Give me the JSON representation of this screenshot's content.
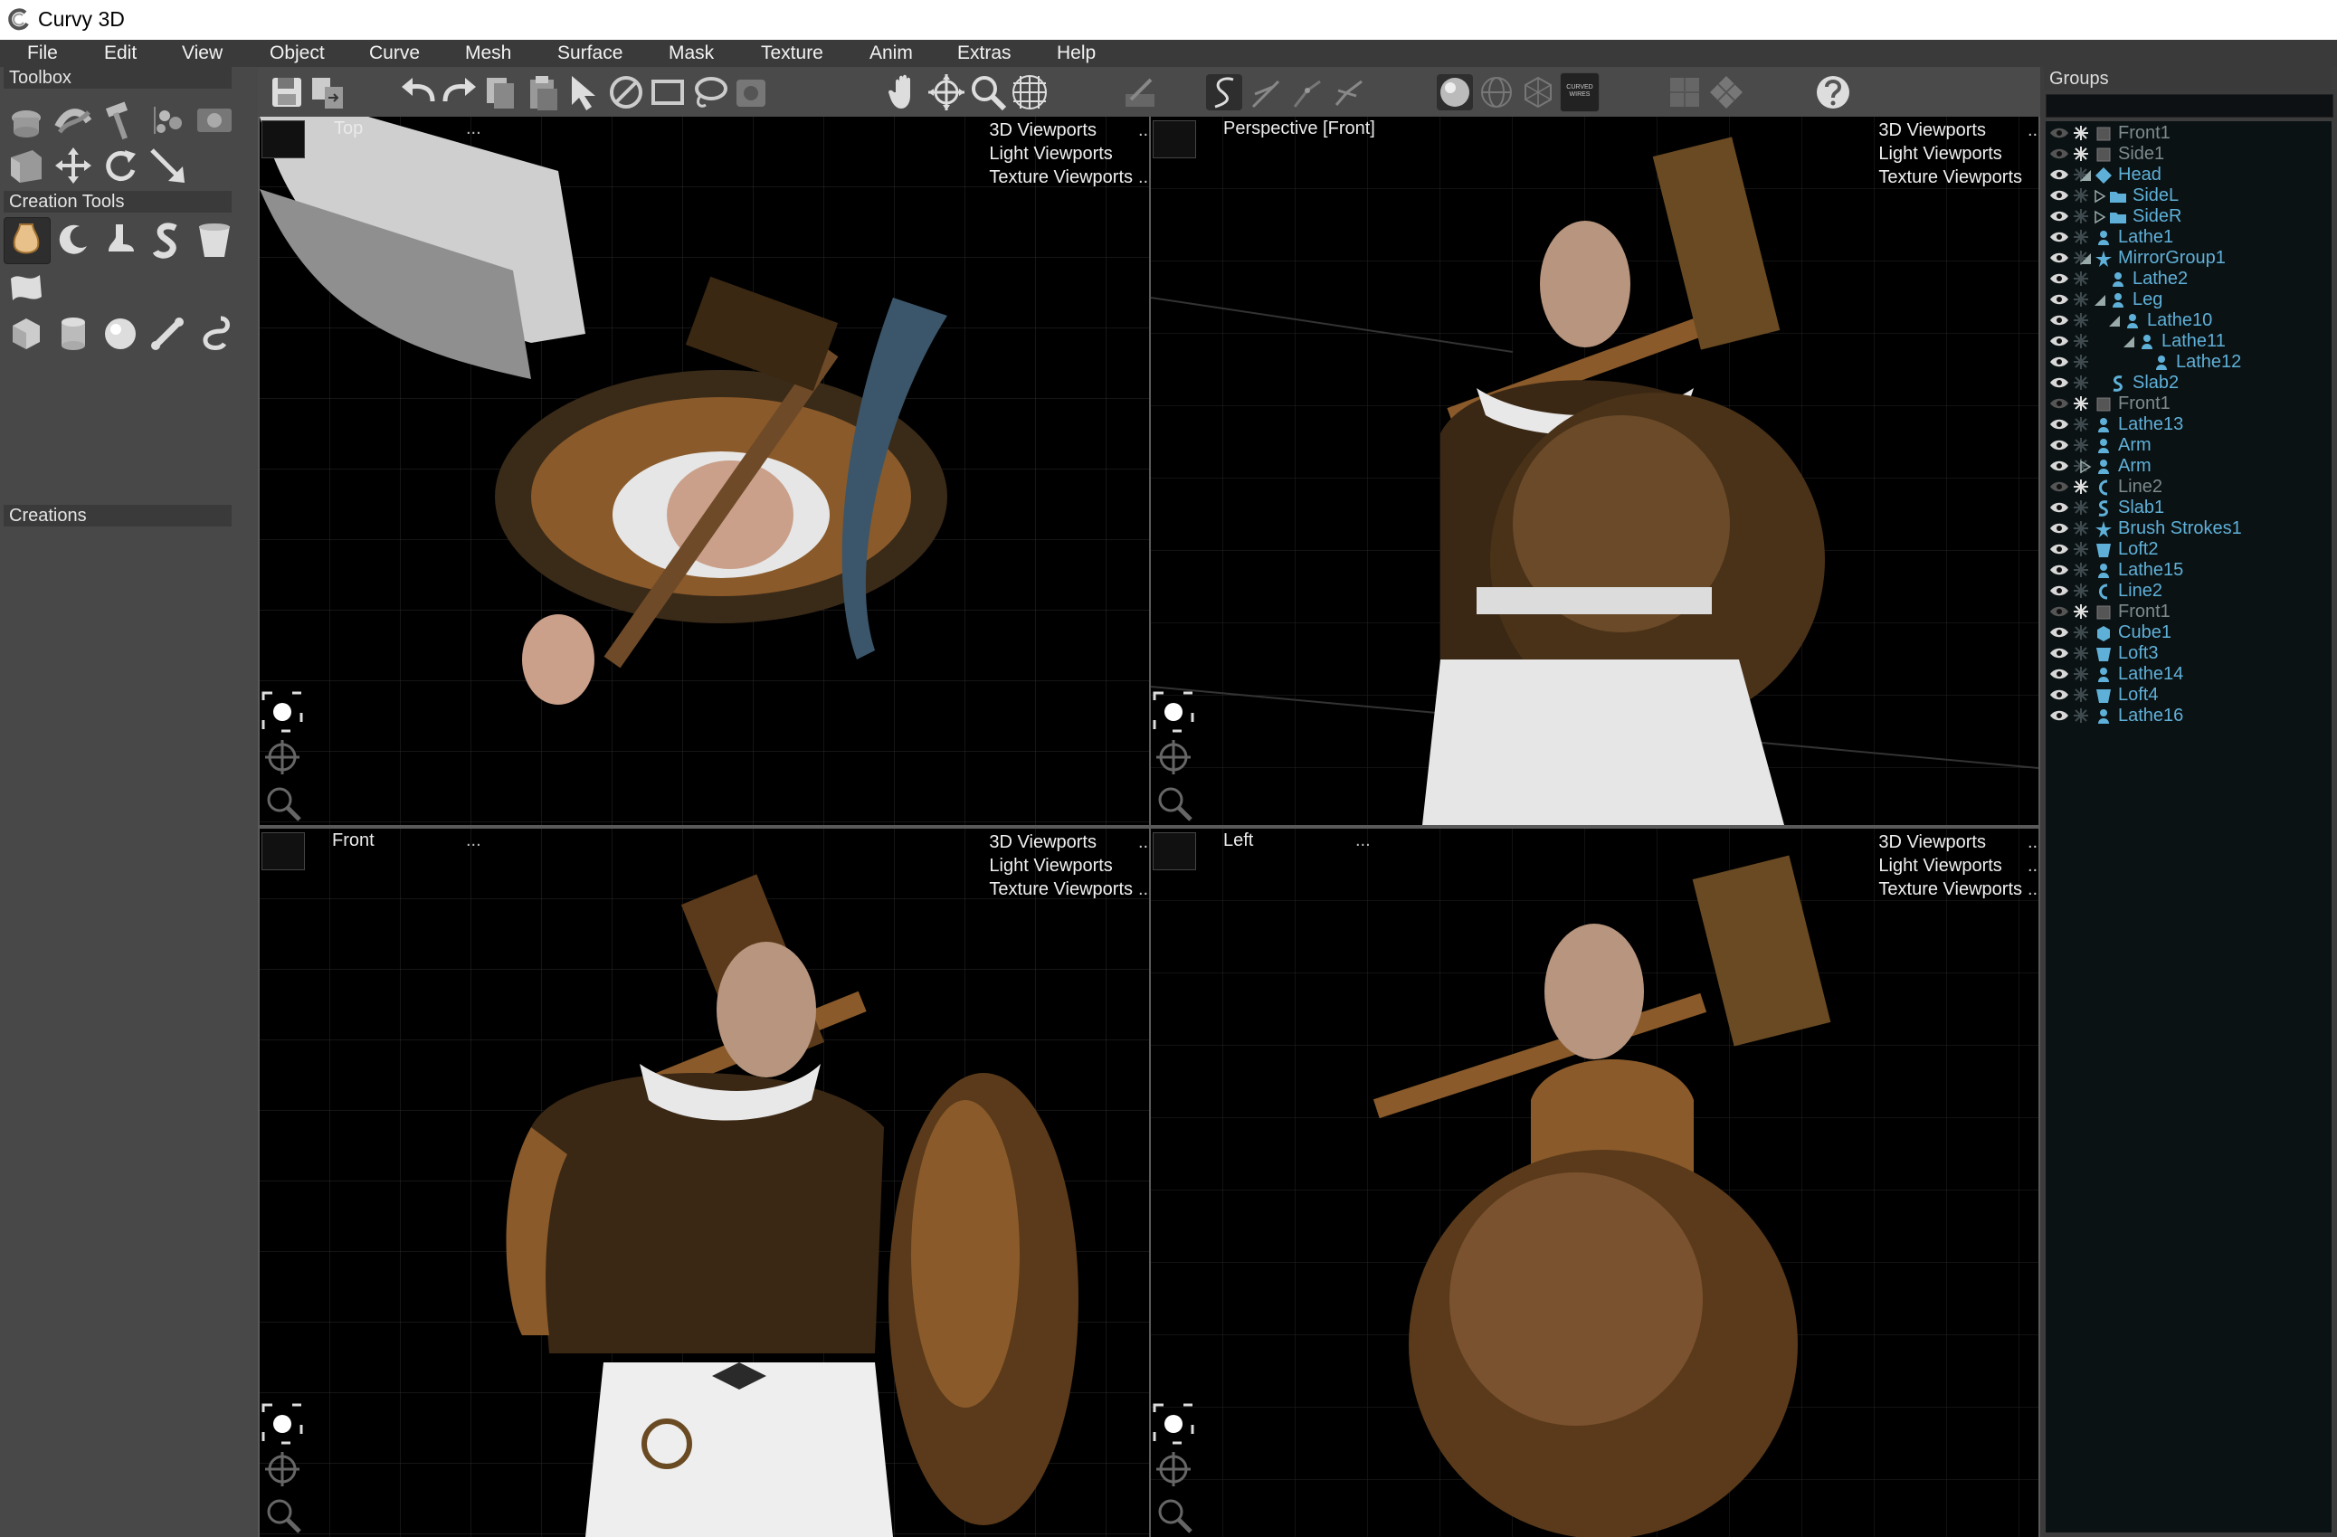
{
  "app": {
    "title": "Curvy 3D"
  },
  "menu": [
    "File",
    "Edit",
    "View",
    "Object",
    "Curve",
    "Mesh",
    "Surface",
    "Mask",
    "Texture",
    "Anim",
    "Extras",
    "Help"
  ],
  "left_panel": {
    "toolbox_label": "Toolbox",
    "creation_tools_label": "Creation Tools",
    "creations_label": "Creations"
  },
  "viewports": [
    {
      "name": "Top",
      "dots": "...",
      "badge": "1",
      "links": [
        "3D Viewports",
        "Light Viewports",
        "Texture Viewports"
      ],
      "more": ".."
    },
    {
      "name": "Perspective [Front]",
      "dots": "",
      "badge": "1",
      "links": [
        "3D Viewports",
        "Light Viewports",
        "Texture Viewports"
      ],
      "more": ".."
    },
    {
      "name": "Front",
      "dots": "...",
      "badge": "1",
      "links": [
        "3D Viewports",
        "Light Viewports",
        "Texture Viewports"
      ],
      "more": ".."
    },
    {
      "name": "Left",
      "dots": "...",
      "badge": "1",
      "links": [
        "3D Viewports",
        "Light Viewports",
        "Texture Viewports"
      ],
      "more": ".."
    }
  ],
  "toolbar": {
    "curved_wires_label": "CURVED WIRES"
  },
  "groups": {
    "title": "Groups",
    "items": [
      {
        "label": "Front1",
        "icon": "image-plane-icon",
        "visible": false,
        "dim": true
      },
      {
        "label": "Side1",
        "icon": "image-plane-icon",
        "visible": false,
        "dim": true
      },
      {
        "label": "Head",
        "icon": "group-diamond-icon",
        "visible": true,
        "expanded": true
      },
      {
        "label": "SideL",
        "icon": "folder-icon",
        "visible": true,
        "collapsed": true
      },
      {
        "label": "SideR",
        "icon": "folder-icon",
        "visible": true,
        "collapsed": true
      },
      {
        "label": "Lathe1",
        "icon": "lathe-icon",
        "visible": true
      },
      {
        "label": "MirrorGroup1",
        "icon": "mirror-star-icon",
        "visible": true,
        "expanded": true
      },
      {
        "label": "Lathe2",
        "icon": "lathe-icon",
        "visible": true
      },
      {
        "label": "Leg",
        "icon": "lathe-icon",
        "visible": true,
        "expanded": true
      },
      {
        "label": "Lathe10",
        "icon": "lathe-icon",
        "visible": true,
        "expanded": true
      },
      {
        "label": "Lathe11",
        "icon": "lathe-icon",
        "visible": true,
        "expanded": true
      },
      {
        "label": "Lathe12",
        "icon": "lathe-icon",
        "visible": true
      },
      {
        "label": "Slab2",
        "icon": "slab-icon",
        "visible": true
      },
      {
        "label": "Front1",
        "icon": "image-plane-icon",
        "visible": false,
        "dim": true
      },
      {
        "label": "Lathe13",
        "icon": "lathe-icon",
        "visible": true
      },
      {
        "label": "Arm",
        "icon": "lathe-icon",
        "visible": true
      },
      {
        "label": "Arm",
        "icon": "lathe-icon",
        "visible": true,
        "collapsed": true
      },
      {
        "label": "Line2",
        "icon": "line-icon",
        "visible": false,
        "dim": true
      },
      {
        "label": "Slab1",
        "icon": "slab-icon",
        "visible": true
      },
      {
        "label": "Brush Strokes1",
        "icon": "brush-star-icon",
        "visible": true
      },
      {
        "label": "Loft2",
        "icon": "loft-icon",
        "visible": true
      },
      {
        "label": "Lathe15",
        "icon": "lathe-icon",
        "visible": true
      },
      {
        "label": "Line2",
        "icon": "line-icon",
        "visible": true
      },
      {
        "label": "Front1",
        "icon": "image-plane-icon",
        "visible": false,
        "dim": true
      },
      {
        "label": "Cube1",
        "icon": "cube-icon",
        "visible": true
      },
      {
        "label": "Loft3",
        "icon": "loft-icon",
        "visible": true
      },
      {
        "label": "Lathe14",
        "icon": "lathe-icon",
        "visible": true
      },
      {
        "label": "Loft4",
        "icon": "loft-icon",
        "visible": true
      },
      {
        "label": "Lathe16",
        "icon": "lathe-icon",
        "visible": true
      }
    ]
  },
  "colors": {
    "accent_text": "#5fb0d8",
    "dim_text": "#7d8a8e",
    "viewport_bg": "#000000",
    "panel_bg": "#484848"
  }
}
